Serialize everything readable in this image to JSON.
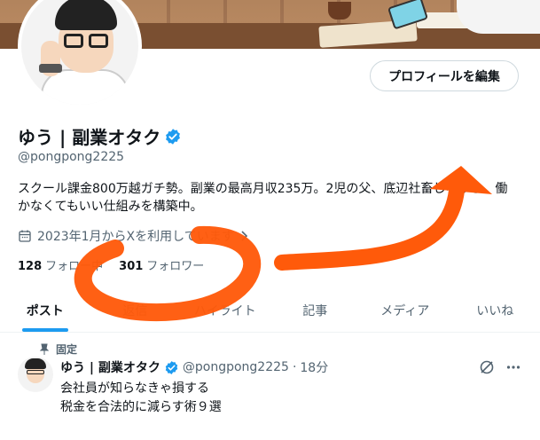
{
  "profile": {
    "edit_button": "プロフィールを編集",
    "display_name": "ゆう | 副業オタク",
    "handle": "@pongpong2225",
    "bio": "スクール課金800万越ガチ勢。副業の最高月収235万。2児の父、底辺社畜しながら、働かなくてもいい仕組みを構築中。",
    "joined": "2023年1月からXを利用しています",
    "following_count": "128",
    "following_label": "フォロー中",
    "followers_count": "301",
    "followers_label": "フォロワー"
  },
  "tabs": [
    {
      "label": "ポスト"
    },
    {
      "label": "返信"
    },
    {
      "label": "ハイライト"
    },
    {
      "label": "記事"
    },
    {
      "label": "メディア"
    },
    {
      "label": "いいね"
    }
  ],
  "pinned_post": {
    "pinned_label": "固定",
    "author_name": "ゆう | 副業オタク",
    "author_handle": "@pongpong2225",
    "separator": "·",
    "time": "18分",
    "line1": "会社員が知らなきゃ損する",
    "line2": "税金を合法的に減らす術９選"
  },
  "colors": {
    "accent": "#1d9bf0",
    "annotation": "#ff5a0a",
    "secondary_text": "#536471"
  },
  "icons": {
    "verified": "verified-badge-icon",
    "calendar": "calendar-icon",
    "chevron": "chevron-right-icon",
    "pin": "pin-icon",
    "grok": "slash-circle-icon",
    "more": "more-dots-icon"
  }
}
